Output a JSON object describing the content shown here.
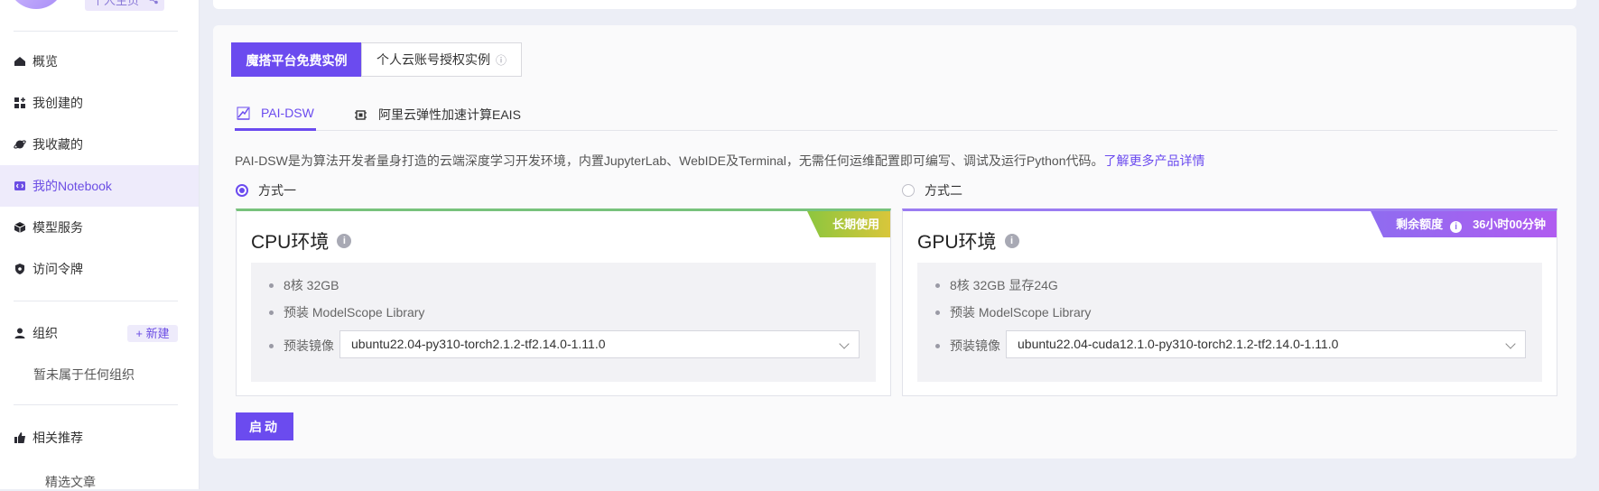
{
  "sidebar": {
    "top_pill": "个人主页",
    "nav": [
      {
        "label": "概览",
        "icon": "home-icon"
      },
      {
        "label": "我创建的",
        "icon": "grid-plus-icon"
      },
      {
        "label": "我收藏的",
        "icon": "planet-icon"
      },
      {
        "label": "我的Notebook",
        "icon": "notebook-icon",
        "active": true
      },
      {
        "label": "模型服务",
        "icon": "cube-icon"
      },
      {
        "label": "访问令牌",
        "icon": "shield-icon"
      }
    ],
    "org": {
      "label": "组织",
      "new_label": "+ 新建",
      "empty_text": "暂未属于任何组织"
    },
    "recommend": {
      "label": "相关推荐",
      "sub_item": "精选文章"
    }
  },
  "main": {
    "instance_tabs": [
      "魔搭平台免费实例",
      "个人云账号授权实例"
    ],
    "info_glyph": "ⓘ",
    "compute_tabs": [
      "PAI-DSW",
      "阿里云弹性加速计算EAIS"
    ],
    "description": "PAI-DSW是为算法开发者量身打造的云端深度学习开发环境，内置JupyterLab、WebIDE及Terminal，无需任何运维配置即可编写、调试及运行Python代码。",
    "learn_more": "了解更多产品详情",
    "option1": "方式一",
    "option2": "方式二",
    "cpu": {
      "title": "CPU环境",
      "badge": "长期使用",
      "specs": [
        "8核 32GB",
        "预装 ModelScope Library"
      ],
      "image_label": "预装镜像",
      "image_value": "ubuntu22.04-py310-torch2.1.2-tf2.14.0-1.11.0"
    },
    "gpu": {
      "title": "GPU环境",
      "badge_label": "剩余额度",
      "badge_value": "36小时00分钟",
      "specs": [
        "8核 32GB 显存24G",
        "预装 ModelScope Library"
      ],
      "image_label": "预装镜像",
      "image_value": "ubuntu22.04-cuda12.1.0-py310-torch2.1.2-tf2.14.0-1.11.0"
    },
    "start_label": "启动"
  },
  "colors": {
    "accent": "#6b4bef",
    "cpu_bar": "#78c27c",
    "gpu_bar": "#9b7cf2"
  }
}
